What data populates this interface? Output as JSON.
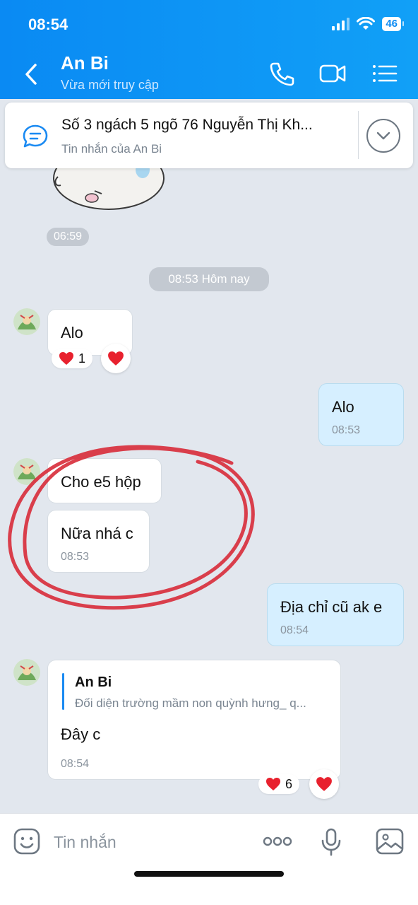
{
  "status_bar": {
    "time": "08:54",
    "battery": "46"
  },
  "header": {
    "name": "An Bi",
    "status": "Vừa mới truy cập"
  },
  "pinned": {
    "title": "Số 3 ngách 5 ngõ 76 Nguyễn Thị Kh...",
    "subtitle": "Tin nhắn của An Bi"
  },
  "chat": {
    "sticker_time": "06:59",
    "day_separator": "08:53 Hôm nay",
    "msg1": {
      "text": "Alo",
      "reaction_count": "1"
    },
    "msg2": {
      "text": "Alo",
      "time": "08:53"
    },
    "msg3": {
      "text": "Cho e5 hộp"
    },
    "msg4": {
      "text": "Nữa nhá c",
      "time": "08:53"
    },
    "msg5": {
      "text": "Địa chỉ cũ ak e",
      "time": "08:54"
    },
    "msg6": {
      "quote_author": "An Bi",
      "quote_text": "Đối diện trường mầm non quỳnh hưng_ q...",
      "text": "Đây c",
      "time": "08:54",
      "reaction_count": "6"
    }
  },
  "input": {
    "placeholder": "Tin nhắn"
  },
  "colors": {
    "header": "#0a8af3",
    "mine_bubble": "#d6efff",
    "annotation": "#d8303d",
    "heart": "#e8212e"
  }
}
